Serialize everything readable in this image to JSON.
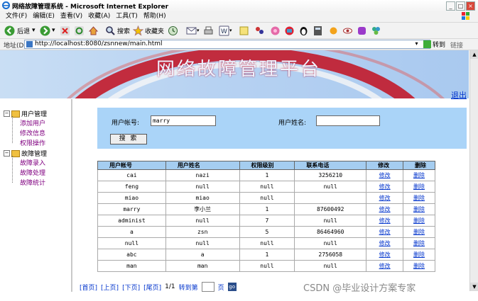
{
  "window": {
    "title": "网络故障管理系统 - Microsoft Internet Explorer"
  },
  "menu": [
    "文件(F)",
    "编辑(E)",
    "查看(V)",
    "收藏(A)",
    "工具(T)",
    "帮助(H)"
  ],
  "toolbar": {
    "back_label": "后退",
    "search_label": "搜索",
    "favorites_label": "收藏夹"
  },
  "address": {
    "label": "地址(D)",
    "url": "http://localhost:8080/zsnnew/main.html",
    "go_label": "转到",
    "links_label": "链接"
  },
  "banner": {
    "title": "网络故障管理平台",
    "logout_label": "退出"
  },
  "sidebar": {
    "groups": [
      {
        "label": "用户管理",
        "items": [
          "添加用户",
          "修改信息",
          "权限操作"
        ]
      },
      {
        "label": "故障管理",
        "items": [
          "故障录入",
          "故障处理",
          "故障统计"
        ]
      }
    ]
  },
  "search": {
    "account_label": "用户帐号:",
    "account_value": "marry",
    "name_label": "用户姓名:",
    "name_value": "",
    "button_label": "搜 索"
  },
  "table": {
    "headers": [
      "用户帐号",
      "用户姓名",
      "权限级别",
      "联系电话",
      "修改",
      "删除"
    ],
    "rows": [
      [
        "cai",
        "nazi",
        "1",
        "3256210",
        "修改",
        "删除"
      ],
      [
        "feng",
        "null",
        "null",
        "null",
        "修改",
        "删除"
      ],
      [
        "miao",
        "miao",
        "null",
        "",
        "修改",
        "删除"
      ],
      [
        "marry",
        "李小兰",
        "1",
        "87600492",
        "修改",
        "删除"
      ],
      [
        "administ",
        "null",
        "7",
        "null",
        "修改",
        "删除"
      ],
      [
        "a",
        "zsn",
        "5",
        "86464960",
        "修改",
        "删除"
      ],
      [
        "null",
        "null",
        "null",
        "null",
        "修改",
        "删除"
      ],
      [
        "abc",
        "a",
        "1",
        "2756058",
        "修改",
        "删除"
      ],
      [
        "man",
        "man",
        "null",
        "null",
        "修改",
        "删除"
      ]
    ]
  },
  "pager": {
    "first": "[首页]",
    "prev": "[上页]",
    "next": "[下页]",
    "last": "[尾页]",
    "page_info": "1/1",
    "goto_label": "转到第",
    "page_suffix": "页",
    "go_button": "go"
  },
  "watermark": "CSDN @毕业设计方案专家"
}
